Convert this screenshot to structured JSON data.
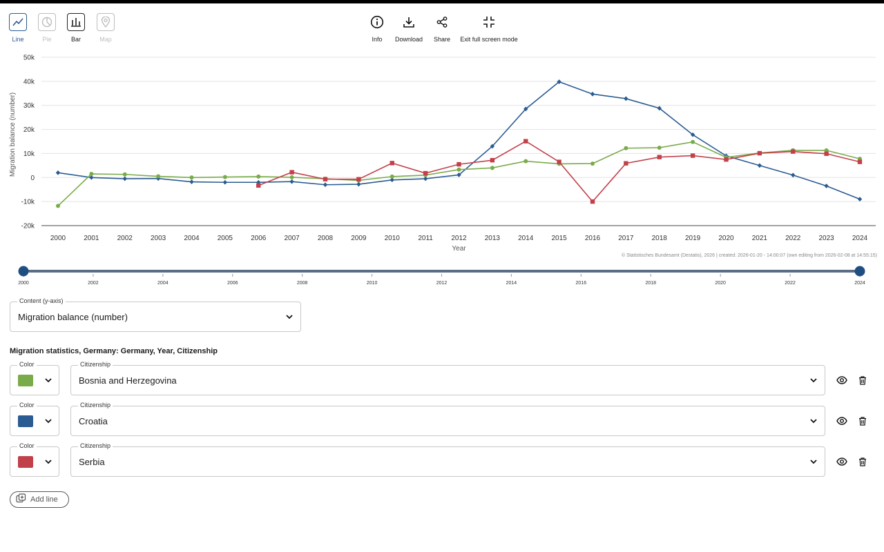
{
  "chart_types": [
    {
      "label": "Line",
      "state": "active",
      "icon": "line-chart-icon"
    },
    {
      "label": "Pie",
      "state": "disabled",
      "icon": "pie-chart-icon"
    },
    {
      "label": "Bar",
      "state": "normal",
      "icon": "bar-chart-icon"
    },
    {
      "label": "Map",
      "state": "disabled",
      "icon": "map-pin-icon"
    }
  ],
  "actions": {
    "info": "Info",
    "download": "Download",
    "share": "Share",
    "exit_fullscreen": "Exit full screen mode"
  },
  "credit": "© Statistisches Bundesamt (Destatis), 2026 | created: 2026-01-20 - 14:00:07 (own editing from 2026-02-08 at 14:55:15)",
  "range_slider": {
    "min": 2000,
    "max": 2024,
    "from": 2000,
    "to": 2024,
    "tick_labels": [
      "2000",
      "2002",
      "2004",
      "2006",
      "2008",
      "2010",
      "2012",
      "2014",
      "2016",
      "2018",
      "2020",
      "2022",
      "2024"
    ]
  },
  "content_select": {
    "label": "Content (y-axis)",
    "value": "Migration balance (number)"
  },
  "section_title": "Migration statistics, Germany: Germany, Year, Citizenship",
  "lines": [
    {
      "color_label": "Color",
      "color": "#7aab4a",
      "citizenship_label": "Citizenship",
      "citizenship": "Bosnia and Herzegovina"
    },
    {
      "color_label": "Color",
      "color": "#2a5b92",
      "citizenship_label": "Citizenship",
      "citizenship": "Croatia"
    },
    {
      "color_label": "Color",
      "color": "#c2404a",
      "citizenship_label": "Citizenship",
      "citizenship": "Serbia"
    }
  ],
  "add_line": "Add line",
  "chart_data": {
    "type": "line",
    "xlabel": "Year",
    "ylabel": "Migration balance (number)",
    "ylim": [
      -20000,
      50000
    ],
    "yticks": [
      -20000,
      -10000,
      0,
      10000,
      20000,
      30000,
      40000,
      50000
    ],
    "ytick_labels": [
      "-20k",
      "-10k",
      "0",
      "10k",
      "20k",
      "30k",
      "40k",
      "50k"
    ],
    "categories": [
      "2000",
      "2001",
      "2002",
      "2003",
      "2004",
      "2005",
      "2006",
      "2007",
      "2008",
      "2009",
      "2010",
      "2011",
      "2012",
      "2013",
      "2014",
      "2015",
      "2016",
      "2017",
      "2018",
      "2019",
      "2020",
      "2021",
      "2022",
      "2023",
      "2024"
    ],
    "grid": true,
    "series": [
      {
        "name": "Croatia",
        "color": "#2a5b92",
        "marker": "diamond",
        "values": [
          2000,
          0,
          -500,
          -400,
          -1800,
          -2000,
          -2000,
          -1700,
          -3000,
          -2800,
          -1000,
          -500,
          1100,
          13000,
          28500,
          39800,
          34700,
          32800,
          28800,
          17800,
          9000,
          5000,
          1000,
          -3500,
          -9000
        ]
      },
      {
        "name": "Bosnia and Herzegovina",
        "color": "#7aab4a",
        "marker": "circle",
        "values": [
          -11800,
          1500,
          1300,
          500,
          0,
          200,
          400,
          100,
          -500,
          -1200,
          400,
          1000,
          3300,
          4000,
          6800,
          5700,
          5800,
          12200,
          12400,
          14800,
          8400,
          10200,
          11300,
          11300,
          7800
        ]
      },
      {
        "name": "Serbia",
        "color": "#c2404a",
        "marker": "square",
        "values": [
          null,
          null,
          null,
          null,
          null,
          null,
          -3300,
          2200,
          -700,
          -700,
          6000,
          1800,
          5500,
          7200,
          15100,
          6500,
          -10000,
          5900,
          8500,
          9100,
          7500,
          10100,
          10800,
          9900,
          6500
        ]
      }
    ]
  }
}
